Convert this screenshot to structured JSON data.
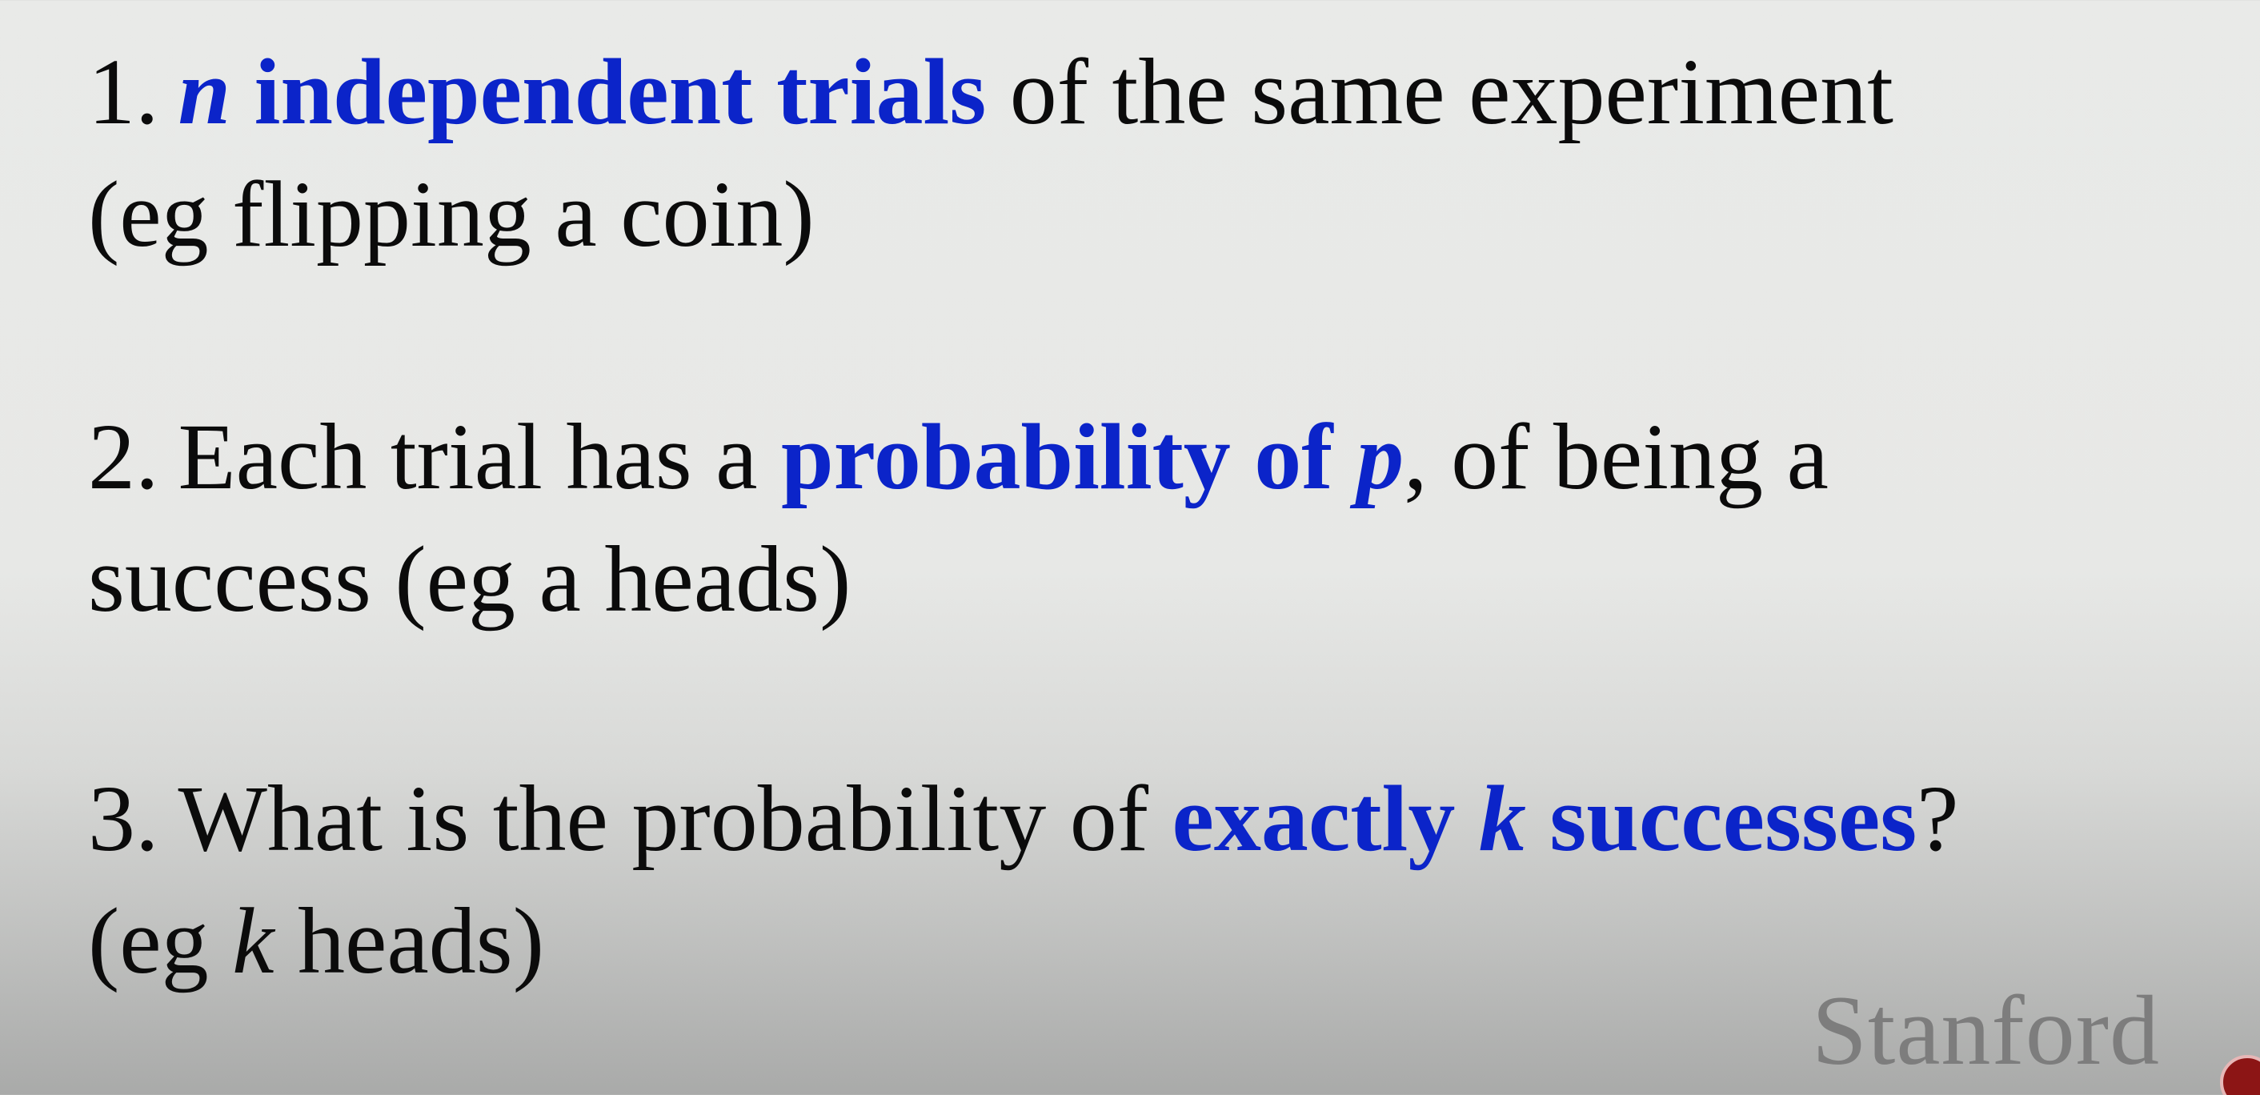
{
  "items": [
    {
      "number": "1.",
      "line1": {
        "variable": "n",
        "highlight": " independent trials",
        "rest": " of the same experiment"
      },
      "line2": "(eg flipping a coin)"
    },
    {
      "number": "2.",
      "line1": {
        "lead": "Each trial has a ",
        "highlight": "probability of ",
        "variable": "p",
        "rest": ", of being a"
      },
      "line2": "success (eg a heads)"
    },
    {
      "number": "3.",
      "line1": {
        "lead": "What is the probability of ",
        "highlight_a": "exactly ",
        "variable": "k",
        "highlight_b": " successes",
        "rest": "?"
      },
      "line2": {
        "lead": "(eg ",
        "variable": "k",
        "rest": " heads)"
      }
    }
  ],
  "logo": {
    "text": "Stanford",
    "seal_icon": "stanford-seal-icon"
  },
  "colors": {
    "highlight": "#0b24c9",
    "text": "#0b0b0b",
    "logo": "#7d7d7d"
  }
}
